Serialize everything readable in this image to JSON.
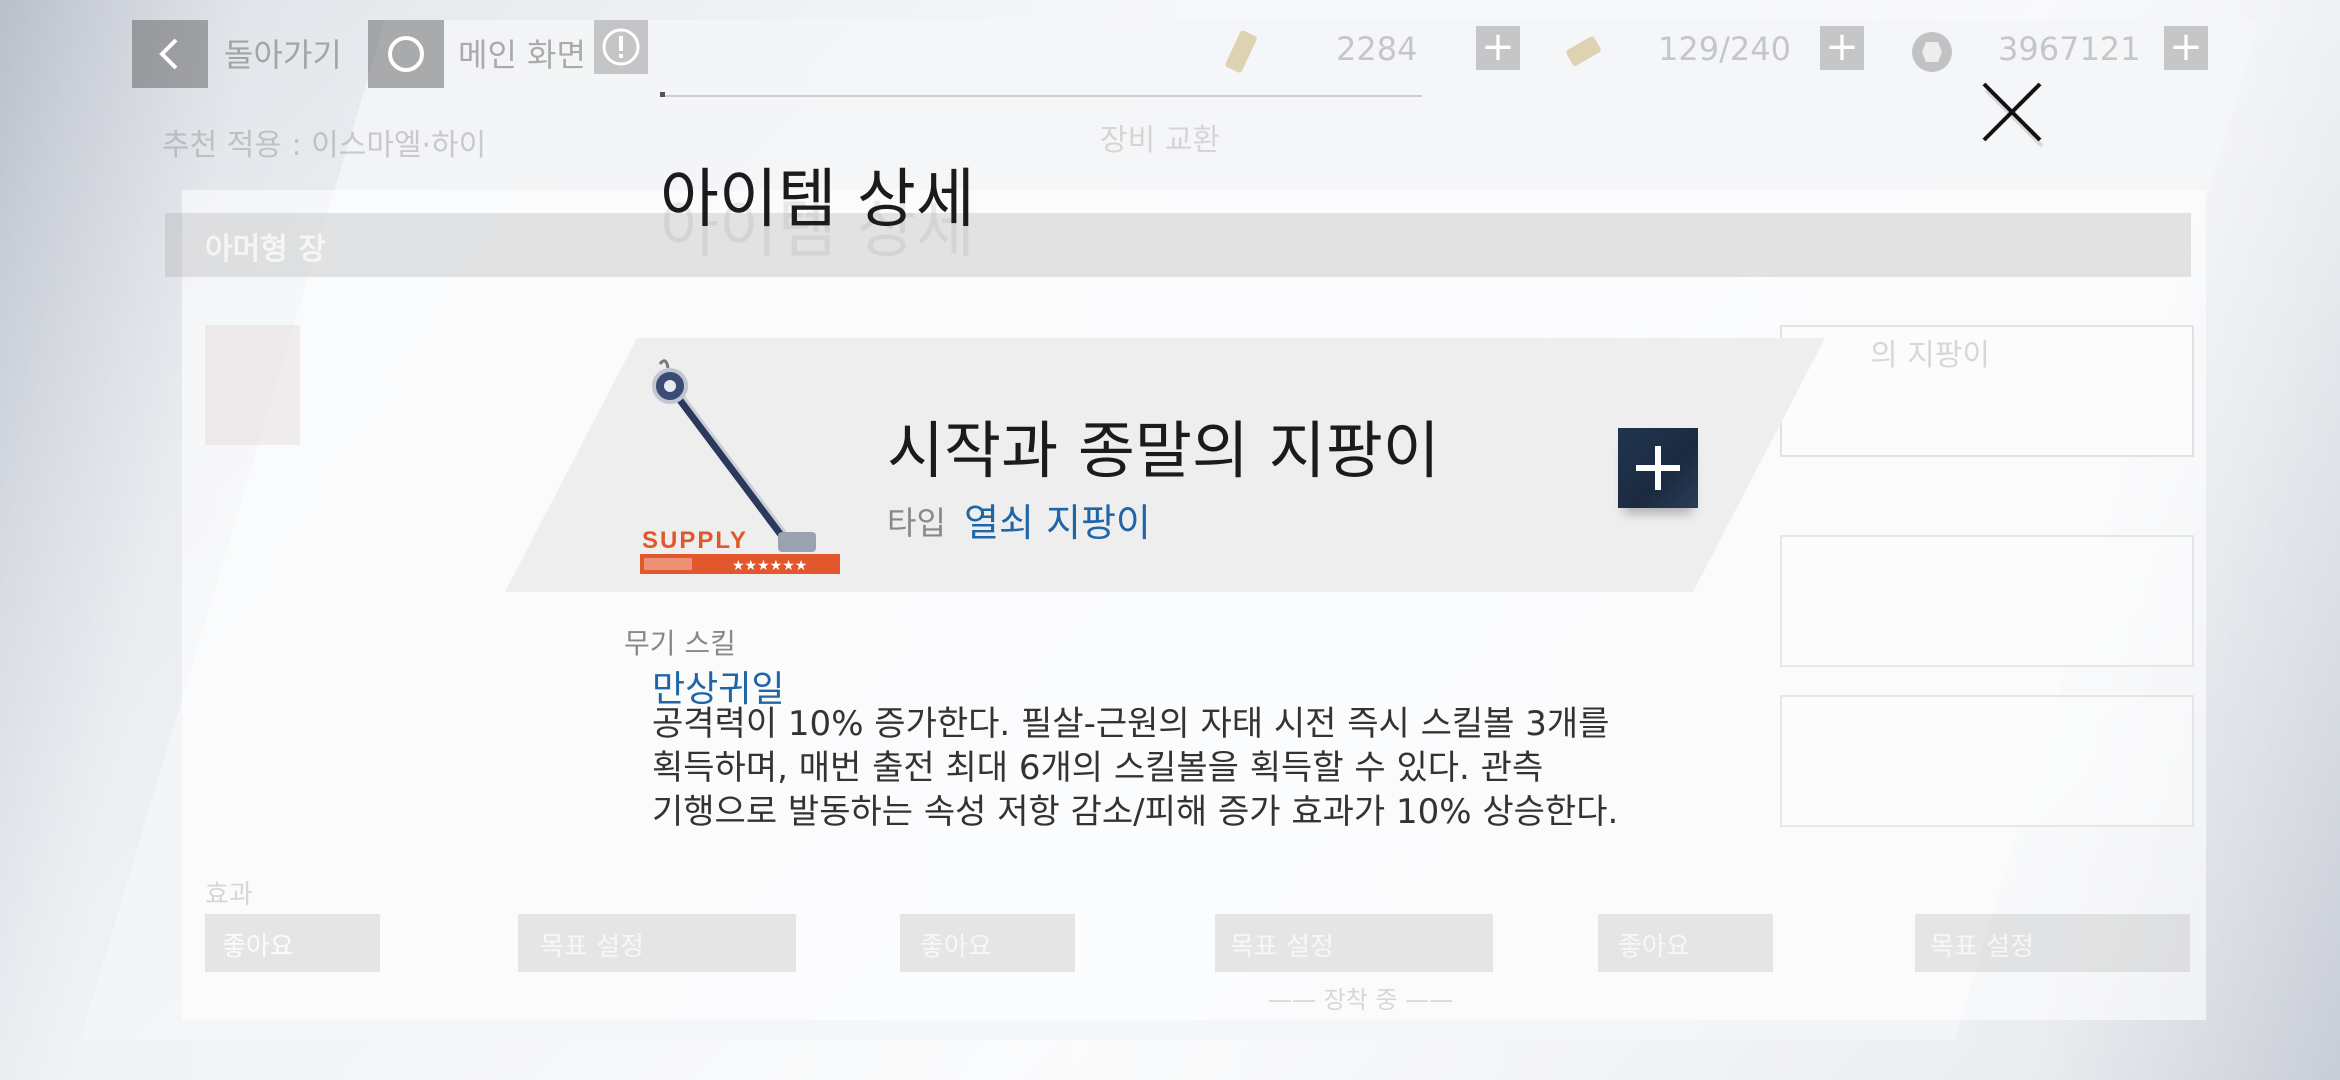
{
  "topbar": {
    "back_label": "돌아가기",
    "main_label": "메인 화면",
    "resources": [
      {
        "icon": "ticket-icon",
        "value": "2284"
      },
      {
        "icon": "stamina-icon",
        "value": "129/240"
      },
      {
        "icon": "coin-icon",
        "value": "3967121"
      }
    ]
  },
  "background": {
    "recommend_text": "추천 적용 : 이스마엘·하이",
    "center_title": "장비 교환",
    "tab_left": "아머형 장",
    "right_item": "의 지팡이",
    "card_label": "효과",
    "like_1": "좋아요",
    "goal_1": "목표 설정",
    "like_2": "좋아요",
    "goal_2": "목표 설정",
    "like_3": "좋아요",
    "goal_3": "목표 설정",
    "equipped": "—— 장착 중 ——"
  },
  "dialog": {
    "title": "아이템 상세",
    "item": {
      "name": "시작과 종말의 지팡이",
      "type_label": "타입",
      "type_value": "열쇠 지팡이",
      "supply_text": "SUPPLY",
      "rarity_stars": "★★★★★★"
    },
    "skill": {
      "heading": "무기 스킬",
      "name": "만상귀일",
      "description_lines": [
        "공격력이 10% 증가한다. 필살-근원의 자태 시전 즉시 스킬볼 3개를",
        "획득하며, 매번 출전 최대 6개의 스킬볼을 획득할 수 있다. 관측",
        "기행으로 발동하는 속성 저항 감소/피해 증가 효과가 10% 상승한다."
      ]
    }
  },
  "colors": {
    "accent_blue": "#1f66a9",
    "supply_orange": "#e2572b",
    "button_navy": "#21344f"
  }
}
